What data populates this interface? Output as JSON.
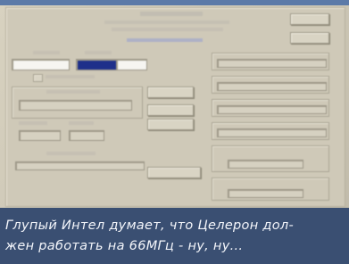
{
  "caption": {
    "line1": "Глупый Интел думает, что Целерон дол-",
    "line2": "жен работать на 66МГц - ну, ну..."
  }
}
